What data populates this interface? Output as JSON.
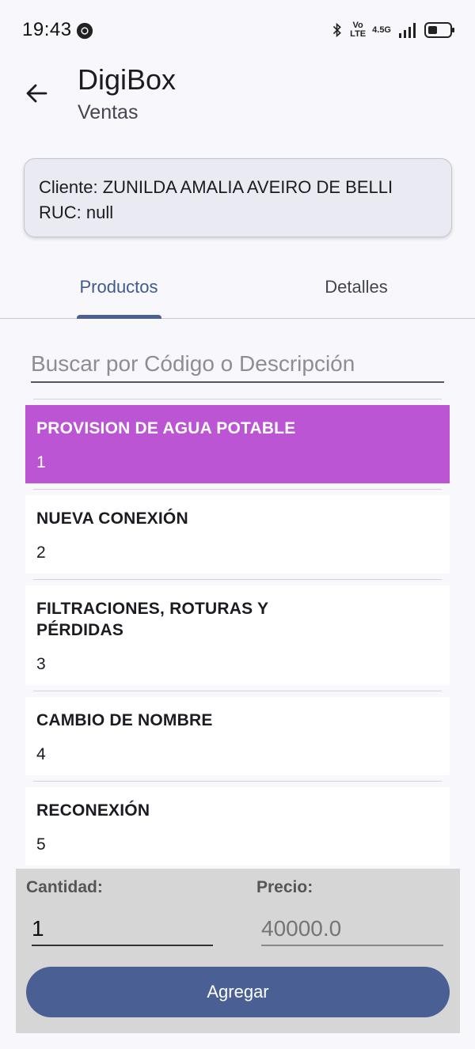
{
  "status_bar": {
    "time": "19:43",
    "volte_top": "Vo",
    "volte_bottom": "LTE",
    "network": "4.5G"
  },
  "app_bar": {
    "title": "DigiBox",
    "subtitle": "Ventas"
  },
  "client": {
    "line1": "Cliente: ZUNILDA AMALIA AVEIRO DE BELLI",
    "line2": "RUC: null"
  },
  "tabs": [
    {
      "label": "Productos",
      "active": true
    },
    {
      "label": "Detalles",
      "active": false
    }
  ],
  "search": {
    "placeholder": "Buscar por Código o Descripción",
    "value": ""
  },
  "products": [
    {
      "name": "PROVISION DE AGUA POTABLE",
      "code": "1",
      "selected": true
    },
    {
      "name": "NUEVA CONEXIÓN",
      "code": "2",
      "selected": false
    },
    {
      "name": "FILTRACIONES, ROTURAS Y PÉRDIDAS",
      "code": "3",
      "selected": false
    },
    {
      "name": "CAMBIO DE NOMBRE",
      "code": "4",
      "selected": false
    },
    {
      "name": "RECONEXIÓN",
      "code": "5",
      "selected": false
    }
  ],
  "order": {
    "quantity_label": "Cantidad:",
    "quantity_value": "1",
    "price_label": "Precio:",
    "price_placeholder": "40000.0",
    "add_label": "Agregar"
  },
  "colors": {
    "accent": "#4a5f94",
    "selected_item": "#bb55d4"
  }
}
